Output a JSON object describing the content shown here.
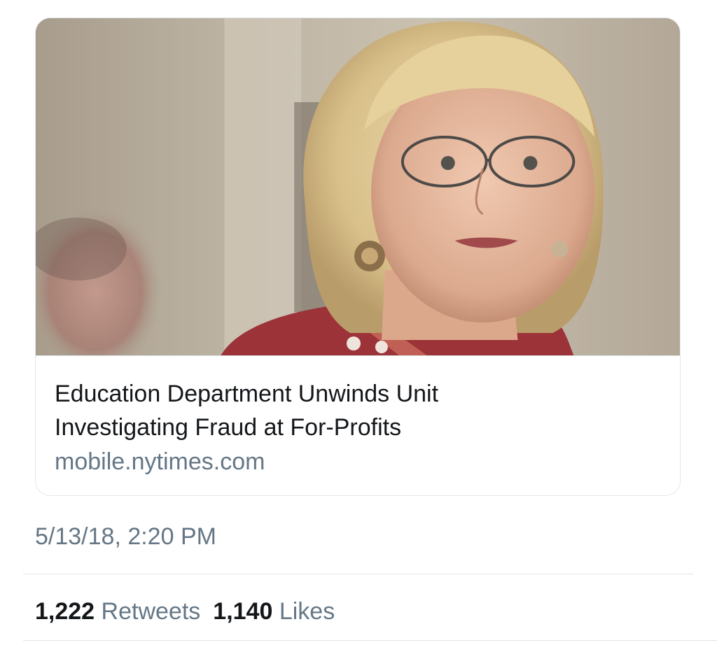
{
  "link_card": {
    "image_description_icon": "portrait-photo",
    "title_line1": "Education Department Unwinds Unit",
    "title_line2": "Investigating Fraud at For-Profits",
    "domain": "mobile.nytimes.com"
  },
  "tweet": {
    "timestamp": "5/13/18, 2:20 PM",
    "retweets_count": "1,222",
    "retweets_label": "Retweets",
    "likes_count": "1,140",
    "likes_label": "Likes"
  },
  "colors": {
    "text_primary": "#14171a",
    "text_secondary": "#657786",
    "border": "#e1e8ed"
  }
}
